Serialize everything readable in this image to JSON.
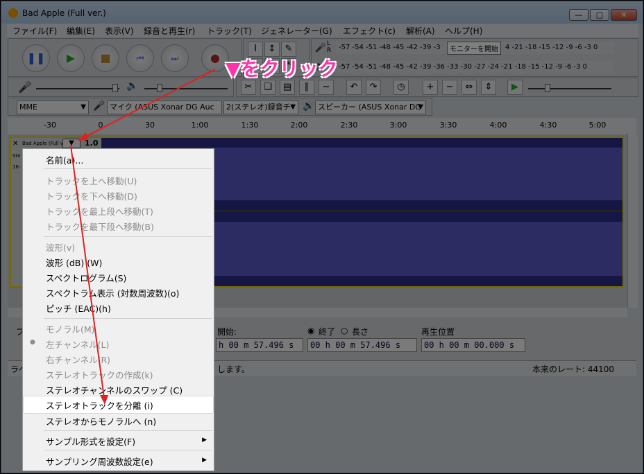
{
  "window": {
    "title": "Bad Apple (Full ver.)"
  },
  "menubar": [
    "ファイル(F)",
    "編集(E)",
    "表示(V)",
    "録音と再生(r)",
    "トラック(T)",
    "ジェネレーター(G)",
    "エフェクト(c)",
    "解析(A)",
    "ヘルプ(H)"
  ],
  "meter": {
    "scale_top": "-57 -54 -51 -48 -45 -42 -39 -3",
    "monitor_button": "モニターを開始",
    "scale_top_right": "4 -21 -18 -15 -12 -9 -6 -3 0",
    "scale_bottom": "-57 -54 -51 -48 -45 -42 -39 -36 -33 -30 -27 -24 -21 -18 -15 -12 -9 -6 -3 0",
    "left_label": "L",
    "right_label": "R"
  },
  "devices": {
    "host": "MME",
    "input": "マイク (ASUS Xonar DG Auc",
    "channels": "2(ステレオ)録音チ",
    "output": "スピーカー (ASUS Xonar DG"
  },
  "ruler": [
    "-30",
    "0",
    "30",
    "1:00",
    "1:30",
    "2:00",
    "2:30",
    "3:00",
    "3:30",
    "4:00",
    "4:30",
    "5:00"
  ],
  "track": {
    "name": "Bad Apple (Full v",
    "gain": "1.0",
    "info_1": "Ste",
    "info_2": "16-",
    "dropdown": "▼"
  },
  "selection": {
    "start_label": "開始:",
    "end_label": "終了",
    "length_label": "長さ",
    "position_label": "再生位置",
    "start_value": "h 00 m 57.496 s",
    "end_value": "00 h 00 m 57.496 s",
    "position_value": "00 h 00 m 00.000 s",
    "left_label": "プ"
  },
  "status": {
    "left": "ラベ",
    "middle": "します。",
    "rate": "本来のレート: 44100"
  },
  "context_menu": {
    "name": "名前(a)...",
    "move_up": "トラックを上へ移動(U)",
    "move_down": "トラックを下へ移動(D)",
    "move_top": "トラックを最上段へ移動(T)",
    "move_bottom": "トラックを最下段へ移動(B)",
    "waveform": "波形(v)",
    "waveform_db": "波形 (dB) (W)",
    "spectrogram": "スペクトログラム(S)",
    "spectrum_log": "スペクトラム表示 (対数周波数)(o)",
    "pitch": "ピッチ (EAC)(h)",
    "mono": "モノラル(M)",
    "left_channel": "左チャンネル(L)",
    "right_channel": "右チャンネル(R)",
    "make_stereo": "ステレオトラックの作成(k)",
    "swap_channels": "ステレオチャンネルのスワップ (C)",
    "split_stereo": "ステレオトラックを分離 (i)",
    "stereo_to_mono": "ステレオからモノラルへ (n)",
    "sample_format": "サンプル形式を設定(F)",
    "sample_rate": "サンプリング周波数設定(e)"
  },
  "annotation": "▼をクリック",
  "colors": {
    "waveform_bg": "#2c2c8a",
    "waveform": "#5858c6",
    "selected_border": "#e3d400",
    "annotation": "#ff33aa",
    "arrow": "#e02020"
  }
}
